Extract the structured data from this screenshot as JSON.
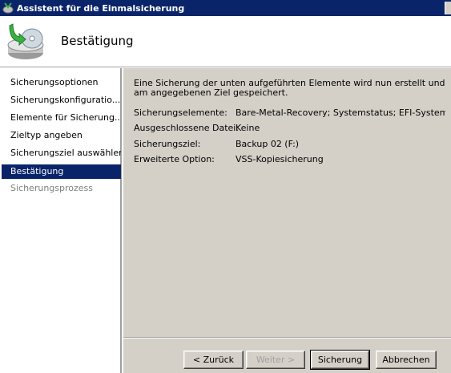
{
  "window": {
    "title": "Assistent für die Einmalsicherung"
  },
  "header": {
    "title": "Bestätigung",
    "icon": "backup-disk-icon"
  },
  "sidebar": {
    "items": [
      {
        "label": "Sicherungsoptionen",
        "state": "normal"
      },
      {
        "label": "Sicherungskonfiguratio...",
        "state": "normal"
      },
      {
        "label": "Elemente für Sicherung...",
        "state": "normal"
      },
      {
        "label": "Zieltyp angeben",
        "state": "normal"
      },
      {
        "label": "Sicherungsziel auswählen",
        "state": "normal"
      },
      {
        "label": "Bestätigung",
        "state": "active"
      },
      {
        "label": "Sicherungsprozess",
        "state": "disabled"
      }
    ]
  },
  "main": {
    "intro": "Eine Sicherung der unten aufgeführten Elemente wird nun erstellt und am angegebenen Ziel gespeichert.",
    "details": [
      {
        "label": "Sicherungselemente:",
        "value": "Bare-Metal-Recovery; Systemstatus; EFI-Systempa..."
      },
      {
        "label": "Ausgeschlossene Datei:",
        "value": "Keine"
      },
      {
        "label": "Sicherungsziel:",
        "value": "Backup 02 (F:)"
      },
      {
        "label": "Erweiterte Option:",
        "value": "VSS-Kopiesicherung"
      }
    ]
  },
  "buttons": {
    "back": "< Zurück",
    "next": "Weiter >",
    "backup": "Sicherung",
    "cancel": "Abbrechen"
  },
  "colors": {
    "titlebar": "#0a246a",
    "selection": "#0a246a",
    "panel": "#d4d0c8"
  }
}
